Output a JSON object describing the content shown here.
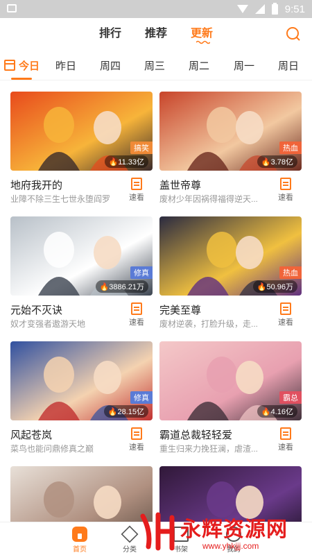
{
  "status_bar": {
    "time": "9:51"
  },
  "top_tabs": [
    {
      "label": "排行",
      "active": false
    },
    {
      "label": "推荐",
      "active": false
    },
    {
      "label": "更新",
      "active": true
    }
  ],
  "day_tabs": [
    {
      "label": "今日",
      "active": true
    },
    {
      "label": "昨日",
      "active": false
    },
    {
      "label": "周四",
      "active": false
    },
    {
      "label": "周三",
      "active": false
    },
    {
      "label": "周二",
      "active": false
    },
    {
      "label": "周一",
      "active": false
    },
    {
      "label": "周日",
      "active": false
    }
  ],
  "comics": [
    {
      "title": "地府我开的",
      "desc": "业障不除三生七世永堕阎罗",
      "tag": "搞笑",
      "tag_color": "#f08a36",
      "count": "11.33亿",
      "read_label": "速看",
      "palette": [
        "#e84a1c",
        "#f7b43a",
        "#3a2a2a"
      ]
    },
    {
      "title": "盖世帝尊",
      "desc": "废材少年因祸得福得逆天...",
      "tag": "热血",
      "tag_color": "#f0643a",
      "count": "3.78亿",
      "read_label": "速看",
      "palette": [
        "#c8442a",
        "#f2c8a0",
        "#6b2a1f"
      ]
    },
    {
      "title": "元始不灭诀",
      "desc": "奴才变强者遨游天地",
      "tag": "修真",
      "tag_color": "#5a7bd6",
      "count": "3886.21万",
      "read_label": "速看",
      "palette": [
        "#b8c0c8",
        "#ffffff",
        "#3c4450"
      ]
    },
    {
      "title": "完美至尊",
      "desc": "废材逆袭，打脸升级，走...",
      "tag": "热血",
      "tag_color": "#f0643a",
      "count": "50.96万",
      "read_label": "速看",
      "palette": [
        "#2a2a40",
        "#f0c040",
        "#603080"
      ]
    },
    {
      "title": "风起苍岚",
      "desc": "菜鸟也能问鼎修真之巅",
      "tag": "修真",
      "tag_color": "#5a7bd6",
      "count": "28.15亿",
      "read_label": "速看",
      "palette": [
        "#3050a0",
        "#f4d2b0",
        "#c03030"
      ]
    },
    {
      "title": "霸道总裁轻轻爱",
      "desc": "重生归来力挽狂澜，虐渣...",
      "tag": "霸总",
      "tag_color": "#e05060",
      "count": "4.16亿",
      "read_label": "速看",
      "palette": [
        "#f4c8c8",
        "#e8a0b0",
        "#40303a"
      ]
    },
    {
      "title": "",
      "desc": "",
      "tag": "",
      "tag_color": "#f08a36",
      "count": "",
      "read_label": "",
      "palette": [
        "#e8e0d8",
        "#b09080",
        "#5a4a40"
      ]
    },
    {
      "title": "",
      "desc": "",
      "tag": "",
      "tag_color": "#f08a36",
      "count": "",
      "read_label": "",
      "palette": [
        "#301838",
        "#6a3a8a",
        "#1a1020"
      ]
    }
  ],
  "bottom_nav": [
    {
      "label": "首页",
      "icon": "home-icon",
      "active": true
    },
    {
      "label": "分类",
      "icon": "category-icon",
      "active": false
    },
    {
      "label": "书架",
      "icon": "bookshelf-icon",
      "active": false
    },
    {
      "label": "我的",
      "icon": "profile-icon",
      "active": false
    }
  ],
  "watermark": {
    "text": "永辉资源网",
    "sub": "www.yhkjjj.com"
  }
}
